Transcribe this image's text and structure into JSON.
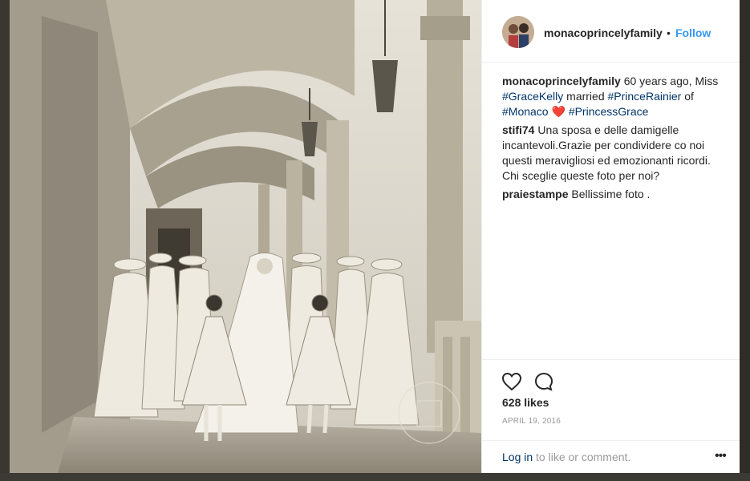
{
  "post": {
    "username": "monacoprincelyfamily",
    "dot": "•",
    "follow_label": "Follow"
  },
  "comments": [
    {
      "user": "monacoprincelyfamily",
      "text1": " 60 years ago, Miss ",
      "tag1": "#GraceKelly",
      "text2": " married ",
      "tag2": "#PrinceRainier",
      "text3": " of ",
      "tag3": "#Monaco",
      "heart": " ❤️ ",
      "tag4": "#PrincessGrace"
    },
    {
      "user": "stifi74",
      "text": " Una sposa e delle damigelle incantevoli.Grazie per condividere co noi questi meravigliosi ed emozionanti ricordi. Chi sceglie queste foto per noi?"
    },
    {
      "user": "praiestampe",
      "text": " Bellissime foto ."
    }
  ],
  "actions": {
    "like_icon": "heart-outline-icon",
    "comment_icon": "comment-bubble-icon",
    "likes_text": "628 likes",
    "date": "APRIL 19, 2016"
  },
  "footer": {
    "login_link": "Log in",
    "login_text": " to like or comment.",
    "more_label": "•••"
  }
}
